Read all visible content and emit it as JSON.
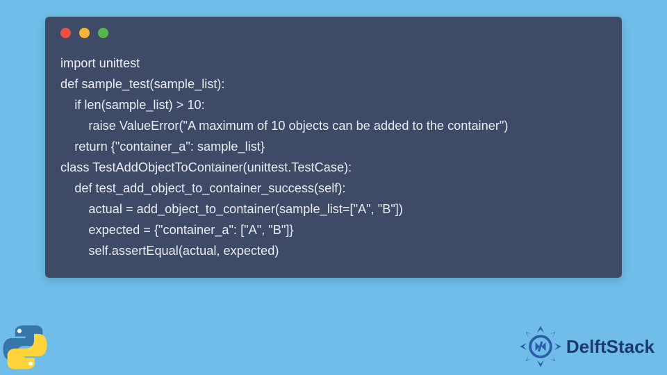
{
  "code": {
    "lines": [
      "import unittest",
      "",
      "def sample_test(sample_list):",
      "    if len(sample_list) > 10:",
      "        raise ValueError(\"A maximum of 10 objects can be added to the container\")",
      "    return {\"container_a\": sample_list}",
      "",
      "class TestAddObjectToContainer(unittest.TestCase):",
      "    def test_add_object_to_container_success(self):",
      "        actual = add_object_to_container(sample_list=[\"A\", \"B\"])",
      "        expected = {\"container_a\": [\"A\", \"B\"]}",
      "        self.assertEqual(actual, expected)"
    ]
  },
  "brand": {
    "name": "DelftStack"
  },
  "colors": {
    "page_bg": "#6fbde8",
    "window_bg": "#3e4a66",
    "code_text": "#e9ecf2",
    "dot_red": "#ec5041",
    "dot_yellow": "#f3b43b",
    "dot_green": "#55b749",
    "brand_text": "#1a3a6e",
    "brand_accent": "#2a5ca8"
  }
}
